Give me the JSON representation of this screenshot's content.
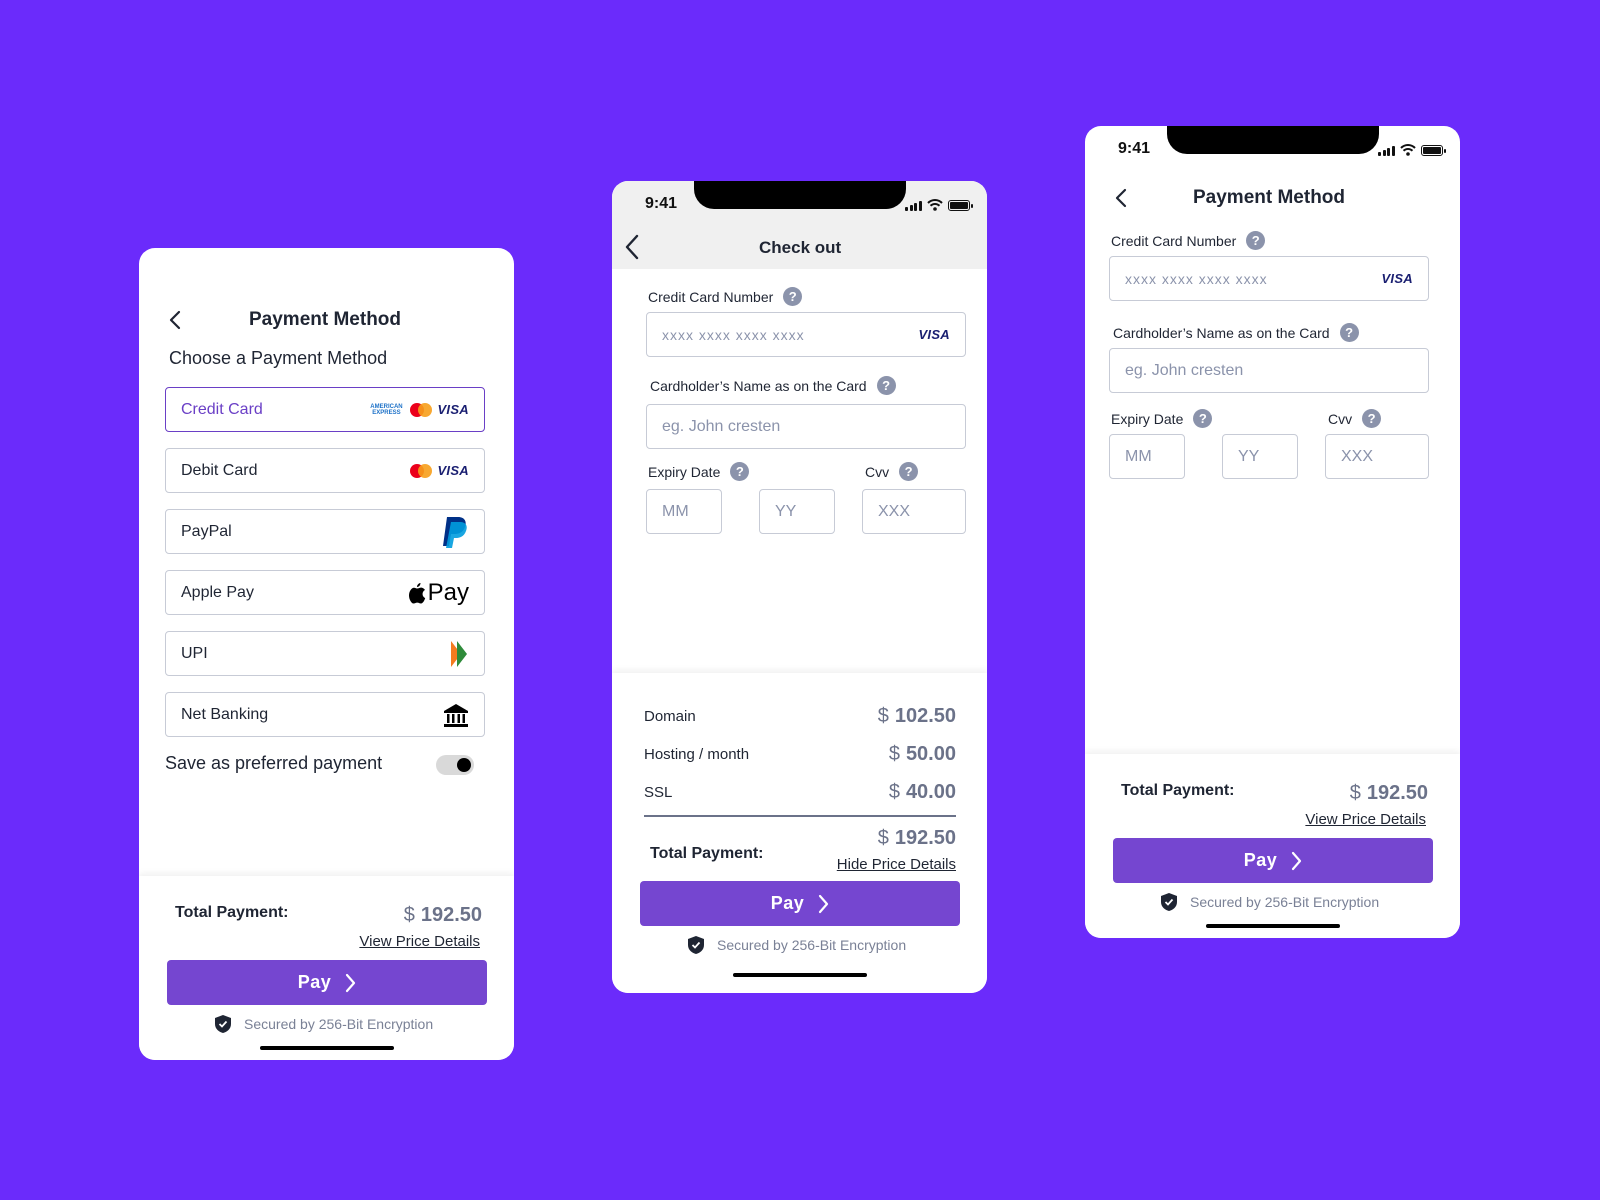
{
  "screen1": {
    "title": "Payment Method",
    "subtitle": "Choose a Payment Method",
    "methods": [
      {
        "label": "Credit Card",
        "icons": [
          "amex-icon",
          "mastercard-icon",
          "visa-icon"
        ],
        "selected": true
      },
      {
        "label": "Debit Card",
        "icons": [
          "mastercard-icon",
          "visa-icon"
        ]
      },
      {
        "label": "PayPal",
        "icons": [
          "paypal-icon"
        ]
      },
      {
        "label": "Apple Pay",
        "icons": [
          "apple-pay-icon"
        ]
      },
      {
        "label": "UPI",
        "icons": [
          "upi-icon"
        ]
      },
      {
        "label": "Net Banking",
        "icons": [
          "bank-icon"
        ]
      }
    ],
    "amex_text": "AMERICAN EXPRESS",
    "visa_text": "VISA",
    "apple_pay_text": "Pay",
    "save_label": "Save as preferred payment",
    "save_toggle_on": true,
    "total_label": "Total Payment:",
    "currency": "$",
    "total_amount": "192.50",
    "details_link": "View Price Details",
    "pay_label": "Pay",
    "secure_text": "Secured by 256-Bit Encryption"
  },
  "screen2": {
    "time": "9:41",
    "title": "Check out",
    "card_number_label": "Credit Card Number",
    "card_number_placeholder": "xxxx  xxxx  xxxx  xxxx",
    "visa_text": "VISA",
    "name_label": "Cardholder’s Name as on the Card",
    "name_placeholder": "eg. John cresten",
    "expiry_label": "Expiry Date",
    "cvv_label": "Cvv",
    "mm_placeholder": "MM",
    "yy_placeholder": "YY",
    "cvv_placeholder": "XXX",
    "help_symbol": "?",
    "prices": [
      {
        "name": "Domain",
        "amount": "102.50"
      },
      {
        "name": "Hosting / month",
        "amount": "50.00"
      },
      {
        "name": "SSL",
        "amount": "40.00"
      }
    ],
    "currency": "$",
    "total_label": "Total Payment:",
    "total_amount": "192.50",
    "details_link": "Hide Price Details",
    "pay_label": "Pay",
    "secure_text": "Secured by 256-Bit Encryption"
  },
  "screen3": {
    "time": "9:41",
    "title": "Payment Method",
    "card_number_label": "Credit Card Number",
    "card_number_placeholder": "xxxx  xxxx  xxxx  xxxx",
    "visa_text": "VISA",
    "name_label": "Cardholder’s Name as on the Card",
    "name_placeholder": "eg. John cresten",
    "expiry_label": "Expiry Date",
    "cvv_label": "Cvv",
    "mm_placeholder": "MM",
    "yy_placeholder": "YY",
    "cvv_placeholder": "XXX",
    "help_symbol": "?",
    "currency": "$",
    "total_label": "Total Payment:",
    "total_amount": "192.50",
    "details_link": "View Price Details",
    "pay_label": "Pay",
    "secure_text": "Secured by 256-Bit Encryption"
  },
  "colors": {
    "background": "#6b2bfb",
    "accent": "#7546d0",
    "selected_border": "#6a3fc6",
    "muted_text": "#8b93ab"
  }
}
